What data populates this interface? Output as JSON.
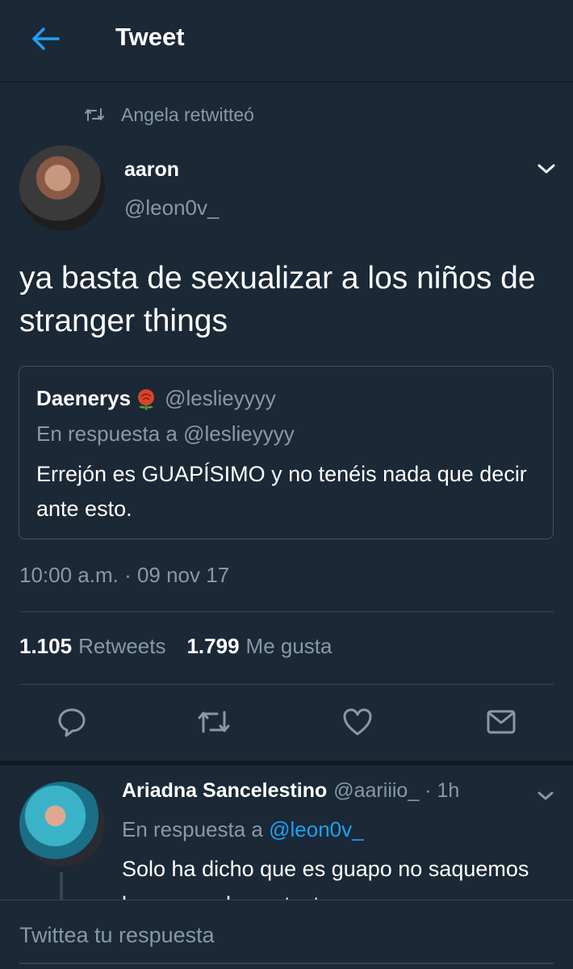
{
  "header": {
    "title": "Tweet",
    "back_icon": "arrow-left-icon"
  },
  "colors": {
    "background": "#1b2836",
    "accent": "#1da1f2",
    "secondary_text": "#8899a6",
    "border": "#38444d"
  },
  "retweet_context": {
    "text": "Angela retwitteó",
    "icon": "retweet-icon"
  },
  "tweet": {
    "author_name": "aaron",
    "author_handle": "@leon0v_",
    "text": "ya basta de sexualizar a los niños de stranger things",
    "timestamp": "10:00 a.m. · 09 nov 17",
    "stats": {
      "retweets_count": "1.105",
      "retweets_label": "Retweets",
      "likes_count": "1.799",
      "likes_label": "Me gusta"
    },
    "actions": [
      "reply-icon",
      "retweet-icon",
      "like-icon",
      "share-icon"
    ]
  },
  "quoted_tweet": {
    "author_name": "Daenerys",
    "emoji": "🌹",
    "author_handle": "@leslieyyyy",
    "reply_to": "En respuesta a @leslieyyyy",
    "text": "Errejón es GUAPÍSIMO y no tenéis nada que decir ante esto."
  },
  "reply": {
    "author_name": "Ariadna Sancelestino",
    "meta": "@aariiio_ · 1h",
    "reply_prefix": "En respuesta a",
    "reply_mention": "@leon0v_",
    "text": "Solo ha dicho que es guapo no saquemos las cosas de contexto por"
  },
  "compose": {
    "placeholder": "Twittea tu respuesta"
  }
}
